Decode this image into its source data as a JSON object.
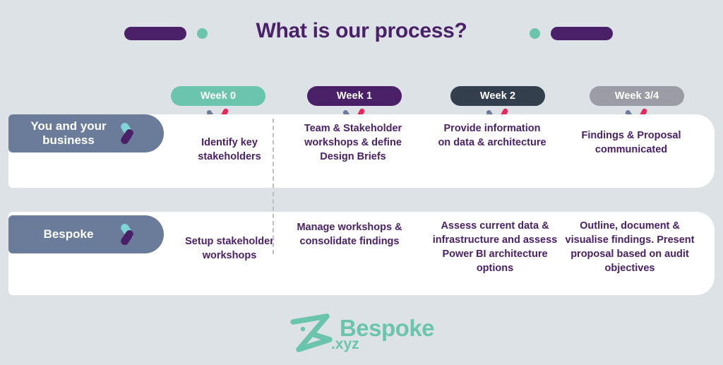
{
  "header": {
    "title": "What is our process?",
    "title_color": "#4A2168",
    "decorations": {
      "pill_left": "deco-pill-left",
      "dot_left": "deco-dot-left",
      "dot_right": "deco-dot-right",
      "pill_right": "deco-pill-right",
      "pill_color": "#4A2168",
      "dot_color": "#6BC4AD"
    }
  },
  "background_color": "#dde2e6",
  "timeline": {
    "weeks": [
      {
        "label": "Week 0",
        "color": "#6BC4AD",
        "text_color": "#ffffff"
      },
      {
        "label": "Week 1",
        "color": "#4A2168",
        "text_color": "#ffffff"
      },
      {
        "label": "Week 2",
        "color": "#333F4D",
        "text_color": "#ffffff"
      },
      {
        "label": "Week 3/4",
        "color": "#9B9CA6",
        "text_color": "#ffffff"
      }
    ],
    "tick_icon": {
      "name": "check-tick-icon",
      "left_color": "#6A7C99",
      "right_color": "#E8265C"
    }
  },
  "rows": [
    {
      "label": "You and your business",
      "label_color": "#6A7C99",
      "icon": {
        "name": "chevron-arrow-icon",
        "top_color": "#7FD4D4",
        "bottom_color": "#4A2168"
      },
      "cells": [
        "Identify key stakeholders",
        "Team & Stakeholder workshops & define Design Briefs",
        "Provide information on data & architecture",
        "Findings & Proposal communicated"
      ]
    },
    {
      "label": "Bespoke",
      "label_color": "#6A7C99",
      "icon": {
        "name": "chevron-arrow-icon",
        "top_color": "#7FD4D4",
        "bottom_color": "#4A2168"
      },
      "cells": [
        "Setup stakeholder workshops",
        "Manage workshops & consolidate findings",
        "Assess current data & infrastructure and assess Power BI architecture options",
        "Outline, document & visualise findings. Present proposal based on audit objectives"
      ]
    }
  ],
  "footer": {
    "logo_name": "Bespoke",
    "logo_tld": ".xyz",
    "logo_color": "#6BC4AD",
    "logo_mark_name": "bespoke-z-logo-mark"
  }
}
